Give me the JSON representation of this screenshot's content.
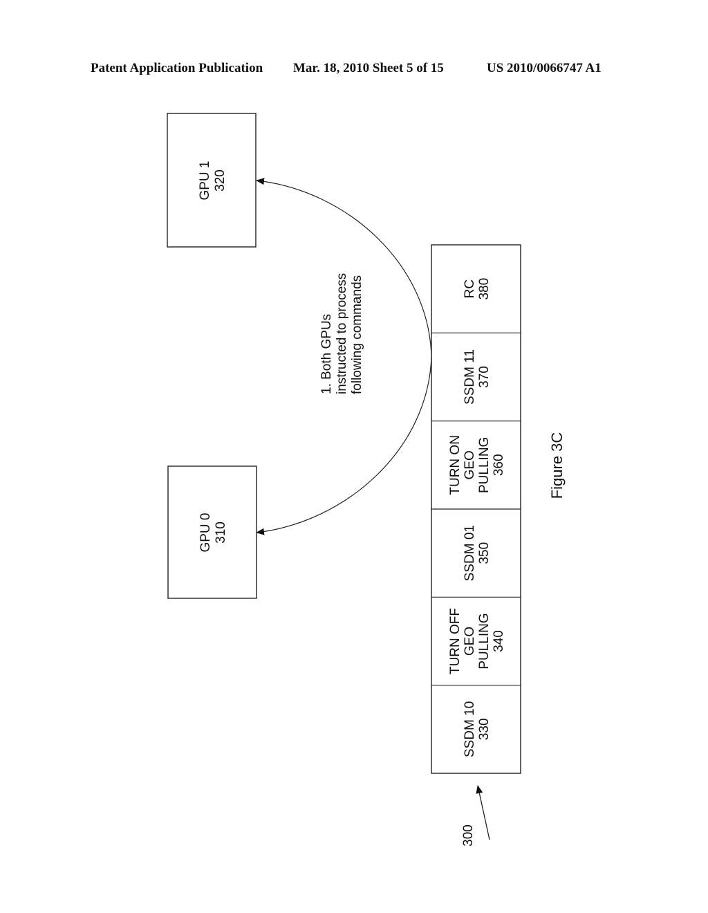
{
  "header": {
    "left": "Patent Application Publication",
    "middle": "Mar. 18, 2010  Sheet 5 of 15",
    "right": "US 2010/0066747 A1"
  },
  "diagram": {
    "gpus": [
      {
        "id": "gpu1",
        "name": "GPU 1",
        "ref": "320"
      },
      {
        "id": "gpu0",
        "name": "GPU 0",
        "ref": "310"
      }
    ],
    "annotation": {
      "lines": [
        "1.  Both GPUs",
        "instructed to process",
        "following commands"
      ]
    },
    "command_buffer": {
      "ref": "300",
      "cells": [
        {
          "lines": [
            "RC",
            "380"
          ]
        },
        {
          "lines": [
            "SSDM 11",
            "370"
          ]
        },
        {
          "lines": [
            "TURN ON",
            "GEO",
            "PULLING",
            "360"
          ]
        },
        {
          "lines": [
            "SSDM 01",
            "350"
          ]
        },
        {
          "lines": [
            "TURN OFF",
            "GEO",
            "PULLING",
            "340"
          ]
        },
        {
          "lines": [
            "SSDM 10",
            "330"
          ]
        }
      ]
    },
    "figure_label": "Figure 3C"
  },
  "colors": {
    "ink": "#111111",
    "paper": "#ffffff"
  }
}
